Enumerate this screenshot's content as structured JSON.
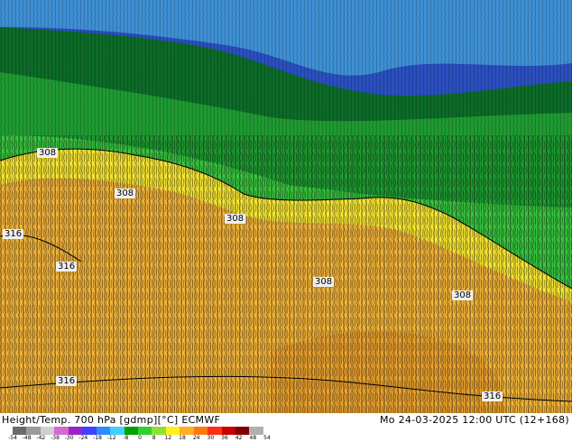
{
  "product": {
    "title": "Height/Temp. 700 hPa [gdmp][°C] ECMWF",
    "valid_time": "Mo 24-03-2025 12:00 UTC (12+168)"
  },
  "contour_labels": [
    "308",
    "308",
    "308",
    "316",
    "316",
    "308",
    "308",
    "316",
    "316"
  ],
  "colorbar": {
    "ticks": [
      "-54",
      "-48",
      "-42",
      "-38",
      "-30",
      "-24",
      "-18",
      "-12",
      "-8",
      "0",
      "8",
      "12",
      "18",
      "24",
      "30",
      "36",
      "42",
      "48",
      "54"
    ],
    "colors": [
      "#6a6a6a",
      "#9a9a9a",
      "#cfcfcf",
      "#d26ad2",
      "#a020c8",
      "#4040ff",
      "#2d8cff",
      "#40d0ff",
      "#00a000",
      "#30d030",
      "#90e030",
      "#fff020",
      "#ffb020",
      "#ff7a10",
      "#ff3010",
      "#c80000",
      "#800000",
      "#b0b0b0"
    ]
  },
  "map_colors": {
    "blue": "#2a4fbf",
    "cyan": "#4ec7e6",
    "dark_green": "#0c6b28",
    "green": "#1f9a32",
    "light_green": "#39c43f",
    "yellow": "#f6e634",
    "orange": "#f2b43a",
    "deep_orange": "#e79a2b"
  }
}
